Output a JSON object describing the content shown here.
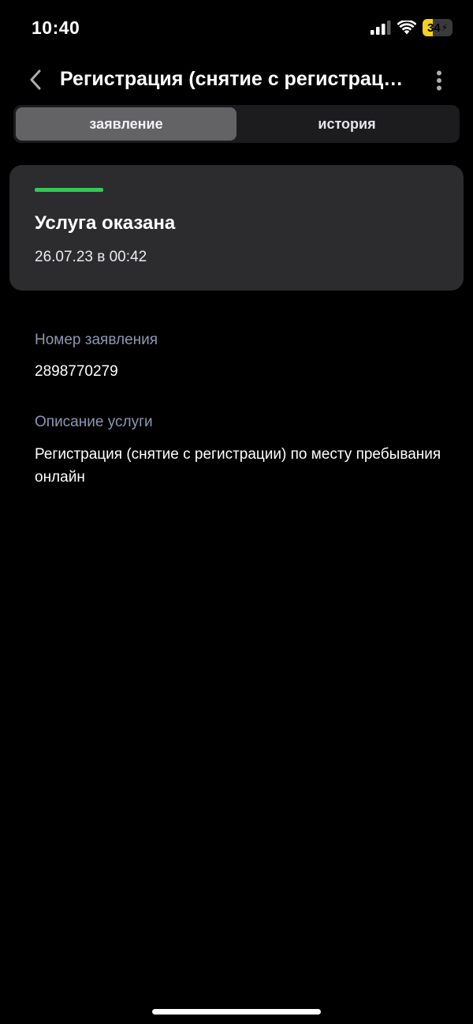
{
  "status_bar": {
    "time": "10:40",
    "battery_percent": "34",
    "battery_level": 0.34,
    "battery_color": "#f5d21d"
  },
  "header": {
    "title": "Регистрация (снятие с регистрации) по месту пребывания онлайн"
  },
  "tabs": [
    {
      "label": "заявление",
      "active": true
    },
    {
      "label": "история",
      "active": false
    }
  ],
  "status_card": {
    "title": "Услуга оказана",
    "date": "26.07.23 в 00:42",
    "indicator_color": "#34c759"
  },
  "details": {
    "number_label": "Номер заявления",
    "number_value": "2898770279",
    "description_label": "Описание услуги",
    "description_value": "Регистрация (снятие с регистрации) по месту пребывания онлайн"
  }
}
